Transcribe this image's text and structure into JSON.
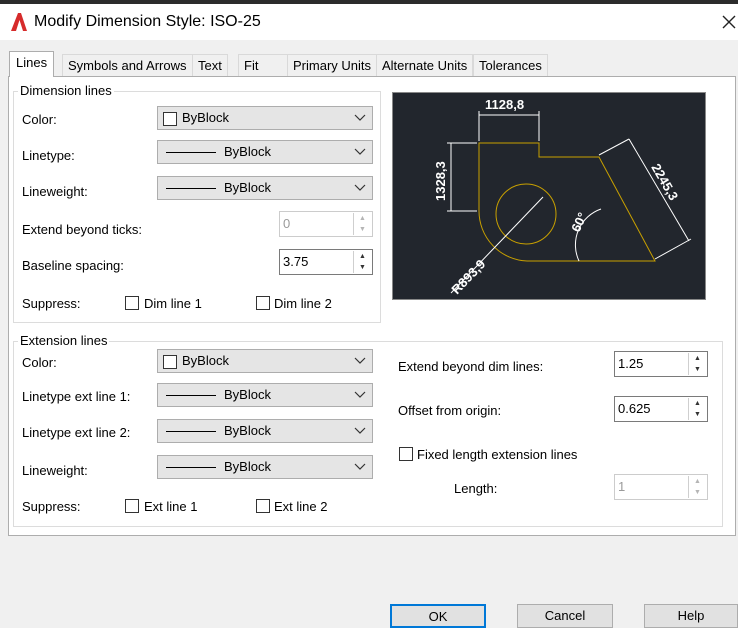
{
  "window": {
    "title": "Modify Dimension Style: ISO-25"
  },
  "tabs": [
    "Lines",
    "Symbols and Arrows",
    "Text",
    "Fit",
    "Primary Units",
    "Alternate Units",
    "Tolerances"
  ],
  "dimension_lines": {
    "legend": "Dimension lines",
    "color_label": "Color:",
    "color_value": "ByBlock",
    "linetype_label": "Linetype:",
    "linetype_value": "ByBlock",
    "lineweight_label": "Lineweight:",
    "lineweight_value": "ByBlock",
    "extend_label": "Extend beyond ticks:",
    "extend_value": "0",
    "baseline_label": "Baseline spacing:",
    "baseline_value": "3.75",
    "suppress_label": "Suppress:",
    "dim_line1": "Dim line 1",
    "dim_line2": "Dim line 2"
  },
  "preview": {
    "dim_top": "1128,8",
    "dim_left": "1328,3",
    "dim_diag": "2245,3",
    "angle": "60°",
    "radius": "R893,9"
  },
  "extension_lines": {
    "legend": "Extension lines",
    "color_label": "Color:",
    "color_value": "ByBlock",
    "ext1_label": "Linetype ext line 1:",
    "ext1_value": "ByBlock",
    "ext2_label": "Linetype ext line 2:",
    "ext2_value": "ByBlock",
    "lineweight_label": "Lineweight:",
    "lineweight_value": "ByBlock",
    "suppress_label": "Suppress:",
    "ext_line1": "Ext line 1",
    "ext_line2": "Ext line 2",
    "extend_dim_label": "Extend beyond dim lines:",
    "extend_dim_value": "1.25",
    "offset_label": "Offset from origin:",
    "offset_value": "0.625",
    "fixed_label": "Fixed length extension lines",
    "length_label": "Length:",
    "length_value": "1"
  },
  "buttons": {
    "ok": "OK",
    "cancel": "Cancel",
    "help": "Help"
  },
  "colors": {
    "preview_bg": "#22262d",
    "geometry": "#c8a000",
    "dims": "#ffffff",
    "accent": "#0078d7"
  }
}
